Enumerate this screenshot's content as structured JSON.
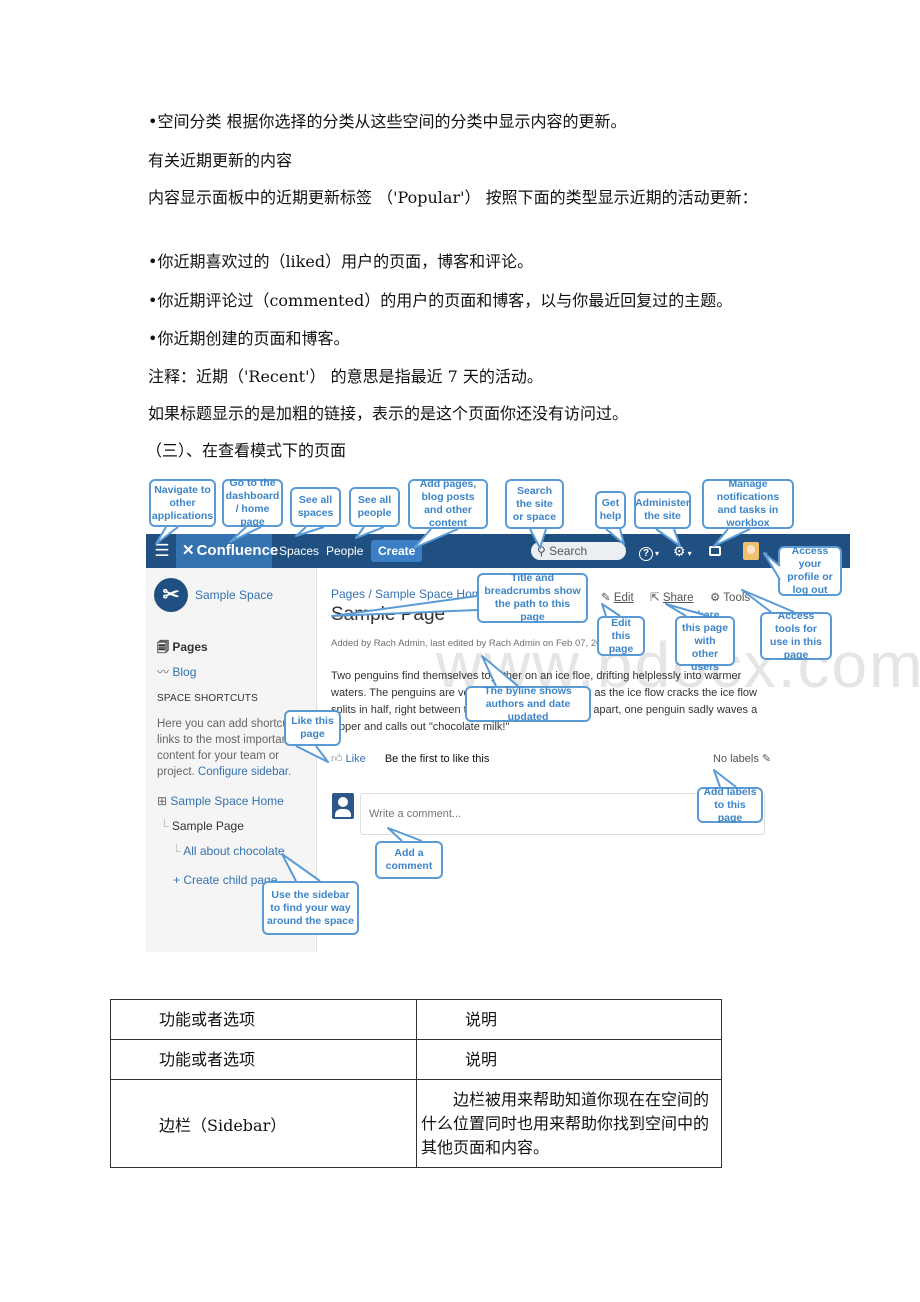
{
  "paragraphs": {
    "p1": "•空间分类 根据你选择的分类从这些空间的分类中显示内容的更新。",
    "p2": "有关近期更新的内容",
    "p3": "内容显示面板中的近期更新标签 （'Popular'） 按照下面的类型显示近期的活动更新：",
    "p4": "•你近期喜欢过的（liked）用户的页面，博客和评论。",
    "p5": "•你近期评论过（commented）的用户的页面和博客，以与你最近回复过的主题。",
    "p6": "•你近期创建的页面和博客。",
    "p7": "注释：近期（'Recent'） 的意思是指最近 7 天的活动。",
    "p8": "如果标题显示的是加粗的链接，表示的是这个页面你还没有访问过。",
    "p9": "（三）、在查看模式下的页面"
  },
  "screenshot": {
    "topbar": {
      "menu_icon": "☰",
      "logo": "Confluence",
      "logo_icon": "✕",
      "spaces": "Spaces",
      "people": "People",
      "create": "Create",
      "search_placeholder": "Search",
      "search_icon": "⌕",
      "help_icon": "?",
      "settings_icon": "⚙",
      "inbox_icon": "▭",
      "dropdown": "▾"
    },
    "sidebar": {
      "space_name": "Sample Space",
      "pages": "Pages",
      "blog": "Blog",
      "shortcuts_heading": "SPACE SHORTCUTS",
      "shortcuts_help": "Here you can add shortcut links to the most important content for your team or project.",
      "configure_link": "Configure sidebar.",
      "tree": [
        "Sample Space Home",
        "Sample Page",
        "All about chocolate"
      ],
      "create_child": "+ Create child page"
    },
    "main": {
      "breadcrumb": "Pages / Sample Space Home",
      "title": "Sample Page",
      "byline": "Added by Rach Admin, last edited by Rach Admin on Feb 07, 2013",
      "edit": "Edit",
      "share": "Share",
      "tools": "Tools",
      "content": "Two penguins find themselves together on an ice floe, drifting helplessly into warmer waters. The penguins are very fond of each other, but as the ice flow cracks the ice flow splits in half, right between the penguins. As they drift apart, one penguin sadly waves a flipper and calls out \"chocolate milk!\"",
      "like": "Like",
      "like_status": "Be the first to like this",
      "labels": "No labels",
      "comment_placeholder": "Write a comment...",
      "watermark": "www.bdocx.com"
    },
    "callouts": {
      "navigate": "Navigate to other applications",
      "dashboard": "Go to the dashboard / home page",
      "spaces": "See all spaces",
      "people": "See all people",
      "create": "Add pages, blog posts and other content",
      "search": "Search the site or space",
      "help": "Get help",
      "admin": "Administer the site",
      "workbox": "Manage notifications and tasks in workbox",
      "profile": "Access your profile or log out",
      "breadcrumbs": "Title and breadcrumbs show the path to this page",
      "edit": "Edit this page",
      "share": "Share this page with other users",
      "tools": "Access tools for use in this page",
      "like": "Like this page",
      "byline": "The byline shows authors and date updated",
      "labels": "Add labels to this page",
      "comment": "Add a comment",
      "sidebar": "Use the sidebar to find your way around the space"
    }
  },
  "table": {
    "rows": [
      [
        "功能或者选项",
        "说明"
      ],
      [
        "功能或者选项",
        "说明"
      ],
      [
        "边栏（Sidebar）",
        "边栏被用来帮助知道你现在在空间的什么位置同时也用来帮助你找到空间中的其他页面和内容。"
      ]
    ]
  },
  "colors": {
    "topbar": "#205081",
    "logo_bg": "#3572b0",
    "link": "#3572b0",
    "callout_border": "#5b9bd5",
    "callout_text": "#3d85c6"
  }
}
